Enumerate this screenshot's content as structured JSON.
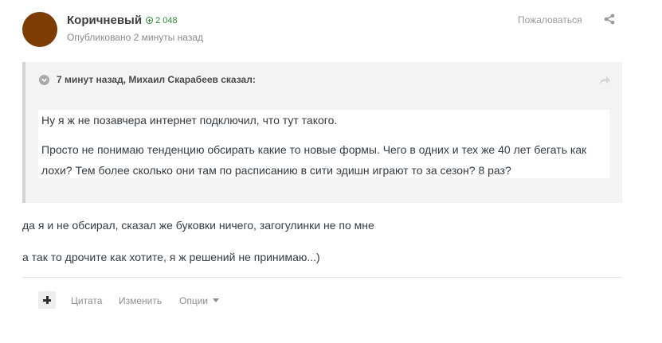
{
  "author": {
    "name": "Коричневый",
    "reputation": "2 048",
    "published": "Опубликовано 2 минуты назад",
    "avatar_color": "#7c3c03"
  },
  "header_actions": {
    "report": "Пожаловаться",
    "share_icon": "share-icon"
  },
  "quote": {
    "header": "7 минут назад, Михаил Скарабеев сказал:",
    "paragraphs": [
      "Ну я ж не позавчера интернет подключил, что тут такого.",
      "Просто не понимаю тенденцию обсирать какие то новые формы. Чего в одних и тех же 40 лет бегать как лохи? Тем более сколько они там по расписанию в сити эдишн играют то за сезон? 8 раз?"
    ]
  },
  "post": {
    "lines": [
      "да я и не обсирал, сказал же буковки ничего, загогулинки не по мне",
      "а так то дрочите как хотите, я ж решений не принимаю...)"
    ]
  },
  "footer": {
    "quote": "Цитата",
    "edit": "Изменить",
    "options": "Опции"
  },
  "colors": {
    "reputation": "#2d8a3a",
    "quote_background": "#f3f3f3",
    "quote_border": "#d4d4d4"
  }
}
